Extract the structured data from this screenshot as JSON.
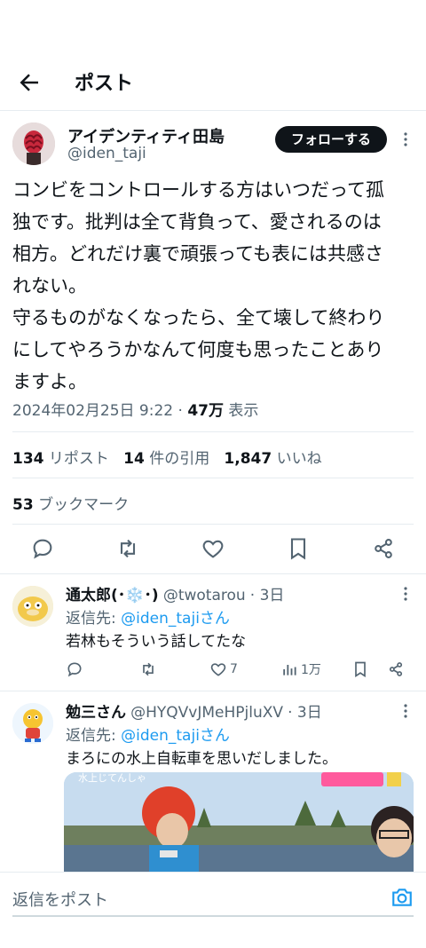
{
  "header": {
    "title": "ポスト"
  },
  "post": {
    "author_name": "アイデンティティ田島",
    "author_handle": "@iden_taji",
    "follow_label": "フォローする",
    "text": "コンビをコントロールする方はいつだって孤\n独です。批判は全て背負って、愛されるのは\n相方。どれだけ裏で頑張っても表には共感さ\nれない。\n守るものがなくなったら、全て壊して終わり\nにしてやろうかなんて何度も思ったことあり\nますよ。",
    "timestamp": "2024年02月25日 9:22",
    "dot": "·",
    "views_count": "47万",
    "views_label": "表示",
    "reposts_count": "134",
    "reposts_label": "リポスト",
    "quotes_count": "14",
    "quotes_label": "件の引用",
    "likes_count": "1,847",
    "likes_label": "いいね",
    "bookmarks_count": "53",
    "bookmarks_label": "ブックマーク"
  },
  "replies": [
    {
      "name": "通太郎(･❄️･)",
      "handle": "@twotarou",
      "time": "· 3日",
      "reply_to_prefix": "返信先: ",
      "reply_to_handle": "@iden_tajiさん",
      "text": "若林もそういう話してたな",
      "likes": "7",
      "views": "1万"
    },
    {
      "name": "勉三さん",
      "handle": "@HYQVvJMeHPjluXV",
      "time": "· 3日",
      "reply_to_prefix": "返信先: ",
      "reply_to_handle": "@iden_tajiさん",
      "text": "まろにの水上自転車を思いだしました。",
      "media_caption": "水上じてんしゃ"
    }
  ],
  "composer": {
    "placeholder": "返信をポスト"
  },
  "colors": {
    "accent": "#1d9bf0",
    "text": "#0f1419",
    "muted": "#536471",
    "divider": "#e6ecf0"
  }
}
